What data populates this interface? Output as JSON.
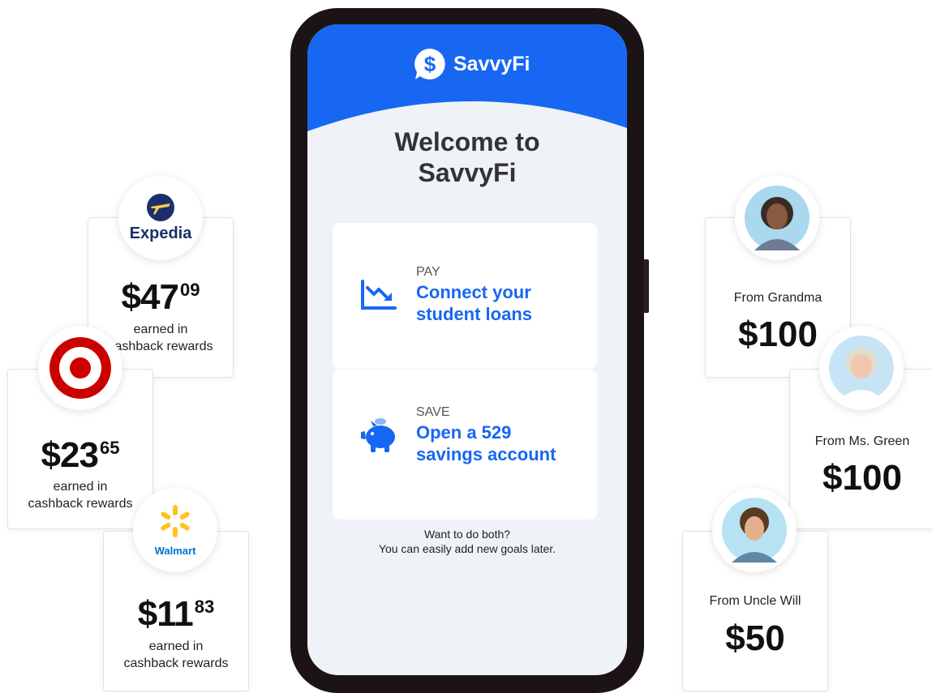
{
  "colors": {
    "brand_blue": "#1767f2",
    "target_red": "#cc0000",
    "walmart_blue": "#0071ce",
    "walmart_yellow": "#ffc220",
    "expedia_navy": "#1b2f6b"
  },
  "app": {
    "name": "SavvyFi",
    "logo_icon": "dollar-chat-bubble-icon",
    "welcome": [
      "Welcome to",
      "SavvyFi"
    ],
    "goals": [
      {
        "label": "PAY",
        "title": [
          "Connect your",
          "student loans"
        ],
        "icon": "trending-down-chart-icon"
      },
      {
        "label": "SAVE",
        "title": [
          "Open a 529",
          "savings account"
        ],
        "icon": "piggy-bank-icon"
      }
    ],
    "note": [
      "Want to do both?",
      "You can easily add new goals later."
    ]
  },
  "rewards": [
    {
      "merchant": "Expedia",
      "amount_whole": "$47",
      "amount_cents": "09",
      "caption": [
        "earned in",
        "cashback rewards"
      ]
    },
    {
      "merchant": "Target",
      "amount_whole": "$23",
      "amount_cents": "65",
      "caption": [
        "earned in",
        "cashback rewards"
      ]
    },
    {
      "merchant": "Walmart",
      "amount_whole": "$11",
      "amount_cents": "83",
      "caption": [
        "earned in",
        "cashback rewards"
      ]
    }
  ],
  "gifts": [
    {
      "from": "From Grandma",
      "amount": "$100"
    },
    {
      "from": "From Ms. Green",
      "amount": "$100"
    },
    {
      "from": "From Uncle Will",
      "amount": "$50"
    }
  ]
}
